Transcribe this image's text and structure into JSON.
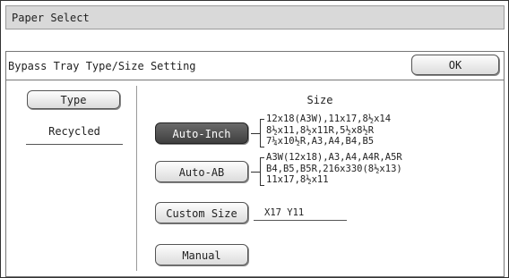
{
  "window": {
    "title": "Paper Select"
  },
  "header": {
    "title": "Bypass Tray Type/Size Setting",
    "ok_label": "OK"
  },
  "type_panel": {
    "type_button_label": "Type",
    "current_type": "Recycled"
  },
  "size_panel": {
    "heading": "Size",
    "auto_inch": {
      "label": "Auto-Inch",
      "selected": true,
      "sizes": [
        "12x18(A3W),11x17,8½x14",
        "8½x11,8½x11R,5½x8½R",
        "7¼x10½R,A3,A4,B4,B5"
      ]
    },
    "auto_ab": {
      "label": "Auto-AB",
      "selected": false,
      "sizes": [
        "A3W(12x18),A3,A4,A4R,A5R",
        "B4,B5,B5R,216x330(8½x13)",
        "11x17,8½x11"
      ]
    },
    "custom_size": {
      "label": "Custom Size",
      "value": "X17 Y11"
    },
    "manual": {
      "label": "Manual"
    }
  }
}
